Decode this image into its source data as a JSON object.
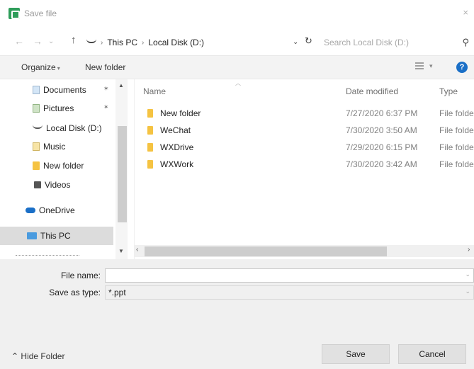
{
  "window": {
    "title": "Save file",
    "close_glyph": "×"
  },
  "nav": {
    "back": "←",
    "forward": "→",
    "recent": "⌄",
    "up": "↑"
  },
  "address": {
    "crumbs": [
      "This PC",
      "Local Disk (D:)"
    ],
    "search_placeholder": "Search Local Disk (D:)"
  },
  "toolbar": {
    "organize": "Organize",
    "new_folder": "New folder",
    "help": "?"
  },
  "sidebar": {
    "items": [
      {
        "label": "Documents",
        "icon": "documents-icon",
        "pinned": true
      },
      {
        "label": "Pictures",
        "icon": "pictures-icon",
        "pinned": true
      },
      {
        "label": "Local Disk (D:)",
        "icon": "drive-icon"
      },
      {
        "label": "Music",
        "icon": "music-icon"
      },
      {
        "label": "New folder",
        "icon": "folder-icon"
      },
      {
        "label": "Videos",
        "icon": "videos-icon"
      },
      {
        "label": "OneDrive",
        "icon": "onedrive-icon"
      },
      {
        "label": "This PC",
        "icon": "this-pc-icon",
        "selected": true
      }
    ]
  },
  "files": {
    "columns": {
      "name": "Name",
      "date": "Date modified",
      "type": "Type"
    },
    "rows": [
      {
        "name": "New folder",
        "date": "7/27/2020 6:37 PM",
        "type": "File folder"
      },
      {
        "name": "WeChat",
        "date": "7/30/2020 3:50 AM",
        "type": "File folder"
      },
      {
        "name": "WXDrive",
        "date": "7/29/2020 6:15 PM",
        "type": "File folder"
      },
      {
        "name": "WXWork",
        "date": "7/30/2020 3:42 AM",
        "type": "File folder"
      }
    ]
  },
  "form": {
    "file_name_label": "File name:",
    "file_name_value": "",
    "save_type_label": "Save as type:",
    "save_type_value": "*.ppt"
  },
  "footer": {
    "hide_folder": "Hide Folder",
    "save": "Save",
    "cancel": "Cancel"
  },
  "colors": {
    "accent": "#1a6fc7",
    "folder": "#f5c342",
    "app_icon": "#2e9d5a"
  }
}
